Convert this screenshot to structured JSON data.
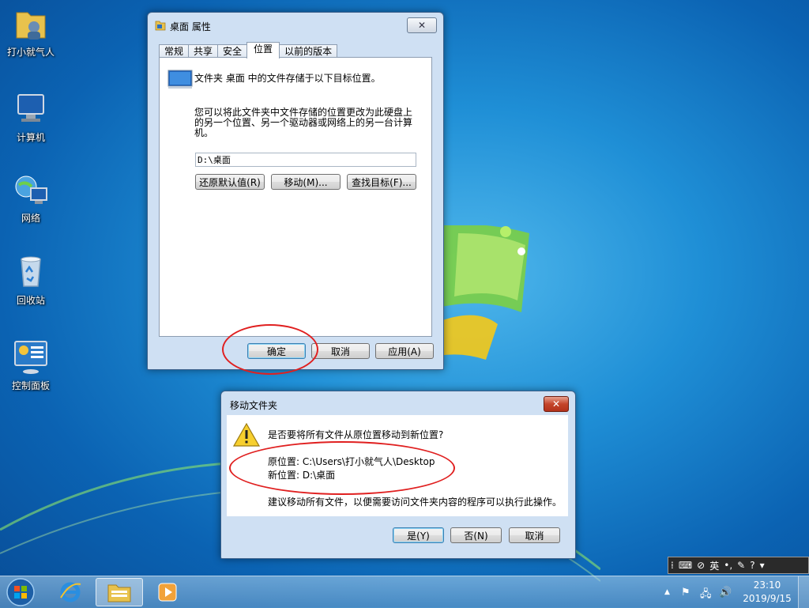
{
  "desktop": {
    "icons": [
      {
        "label": "打小就气人",
        "icon": "user-folder-icon"
      },
      {
        "label": "计算机",
        "icon": "computer-icon"
      },
      {
        "label": "网络",
        "icon": "network-icon"
      },
      {
        "label": "回收站",
        "icon": "recycle-bin-icon"
      },
      {
        "label": "控制面板",
        "icon": "control-panel-icon"
      }
    ]
  },
  "props_dialog": {
    "title": "桌面 属性",
    "close_glyph": "✕",
    "tabs": [
      "常规",
      "共享",
      "安全",
      "位置",
      "以前的版本"
    ],
    "active_tab": "位置",
    "description": "文件夹 桌面 中的文件存储于以下目标位置。",
    "help_text": "您可以将此文件夹中文件存储的位置更改为此硬盘上的另一个位置、另一个驱动器或网络上的另一台计算机。",
    "path_value": "D:\\桌面",
    "restore_label": "还原默认值(R)",
    "move_label": "移动(M)...",
    "find_label": "查找目标(F)...",
    "ok_label": "确定",
    "cancel_label": "取消",
    "apply_label": "应用(A)"
  },
  "move_dialog": {
    "title": "移动文件夹",
    "close_glyph": "✕",
    "question": "是否要将所有文件从原位置移动到新位置?",
    "old_location": "原位置: C:\\Users\\打小就气人\\Desktop",
    "new_location": "新位置: D:\\桌面",
    "advice": "建议移动所有文件，以便需要访问文件夹内容的程序可以执行此操作。",
    "yes_label": "是(Y)",
    "no_label": "否(N)",
    "cancel_label": "取消"
  },
  "taskbar": {
    "time": "23:10",
    "date": "2019/9/15",
    "language": "英",
    "tray_expand": "▲"
  },
  "colors": {
    "annotation_ring": "#e02020",
    "close_button_red": "#c4452b"
  }
}
